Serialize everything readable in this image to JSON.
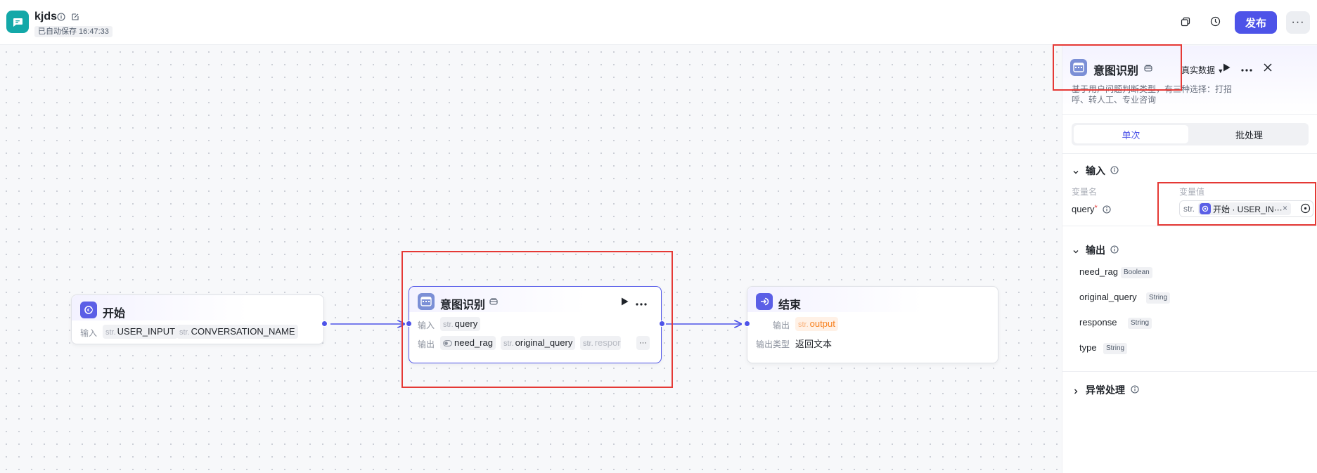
{
  "header": {
    "app_title": "kjds",
    "autosave": "已自动保存 16:47:33",
    "publish_label": "发布",
    "more_label": "···"
  },
  "canvas": {
    "start_node": {
      "title": "开始",
      "input_label": "输入",
      "inputs": [
        {
          "type": "str.",
          "name": "USER_INPUT"
        },
        {
          "type": "str.",
          "name": "CONVERSATION_NAME"
        }
      ]
    },
    "intent_node": {
      "title": "意图识别",
      "input_label": "输入",
      "output_label": "输出",
      "input_tag": {
        "type": "str.",
        "name": "query"
      },
      "outputs": [
        {
          "type": "",
          "name": "need_rag"
        },
        {
          "type": "str.",
          "name": "original_query"
        },
        {
          "type": "str.",
          "name": "respor"
        }
      ],
      "overflow_label": "···"
    },
    "end_node": {
      "title": "结束",
      "output_label": "输出",
      "output_tag": {
        "type": "str.",
        "name": "output"
      },
      "output_type_label": "输出类型",
      "output_type_value": "返回文本"
    },
    "colors": {
      "accent": "#4d53e8",
      "edge": "#4d53e8",
      "highlight": "#e53935"
    }
  },
  "panel": {
    "title": "意图识别",
    "real_data_label": "真实数据",
    "description": "基于用户问题判断类型，有三种选择：打招呼、转人工、专业咨询",
    "tabs": [
      {
        "label": "单次",
        "active": true
      },
      {
        "label": "批处理",
        "active": false
      }
    ],
    "input_section": {
      "title": "输入",
      "col_name": "变量名",
      "col_value": "变量值",
      "field_name": "query",
      "required_mark": "*",
      "ref_type": "str.",
      "ref_value": "开始 · USER_IN···",
      "clear_label": "×"
    },
    "output_section": {
      "title": "输出",
      "items": [
        {
          "name": "need_rag",
          "type": "Boolean"
        },
        {
          "name": "original_query",
          "type": "String"
        },
        {
          "name": "response",
          "type": "String"
        },
        {
          "name": "type",
          "type": "String"
        }
      ]
    },
    "error_section": {
      "title": "异常处理"
    }
  }
}
